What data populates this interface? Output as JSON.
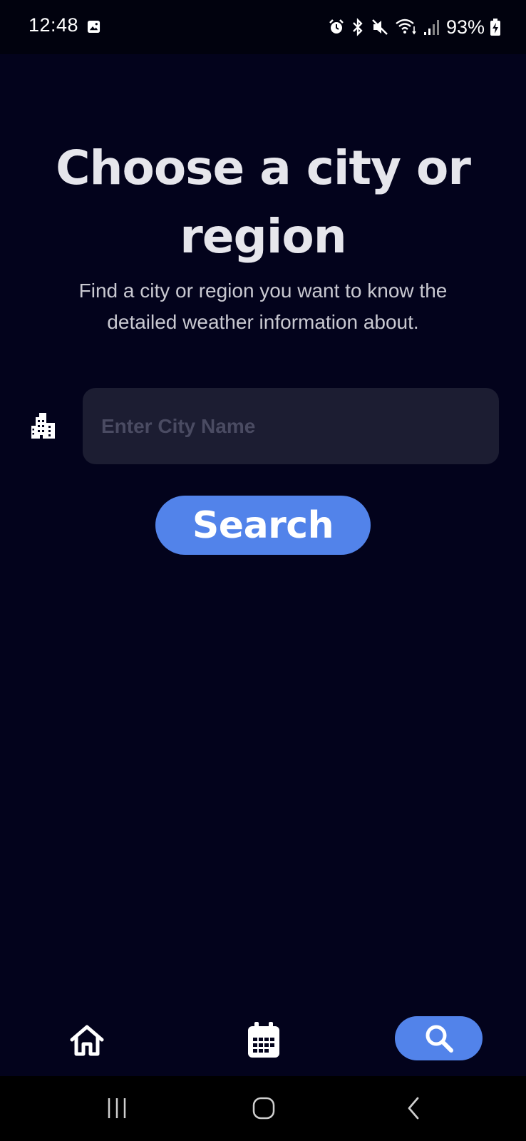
{
  "status_bar": {
    "time": "12:48",
    "battery_percent": "93%",
    "icons": [
      "gallery-icon",
      "alarm-icon",
      "bluetooth-icon",
      "mute-icon",
      "wifi-icon",
      "signal-icon",
      "battery-charging-icon"
    ]
  },
  "main": {
    "title": "Choose a city or region",
    "subtitle": "Find a city or region you want to know the detailed weather information about.",
    "city_input": {
      "placeholder": "Enter City Name",
      "value": ""
    },
    "search_button_label": "Search"
  },
  "bottom_nav": {
    "items": [
      {
        "icon": "home-icon",
        "active": false
      },
      {
        "icon": "calendar-icon",
        "active": false
      },
      {
        "icon": "search-icon",
        "active": true
      }
    ]
  },
  "colors": {
    "background": "#03031c",
    "accent": "#5283ea",
    "input_bg": "#1c1d32"
  }
}
